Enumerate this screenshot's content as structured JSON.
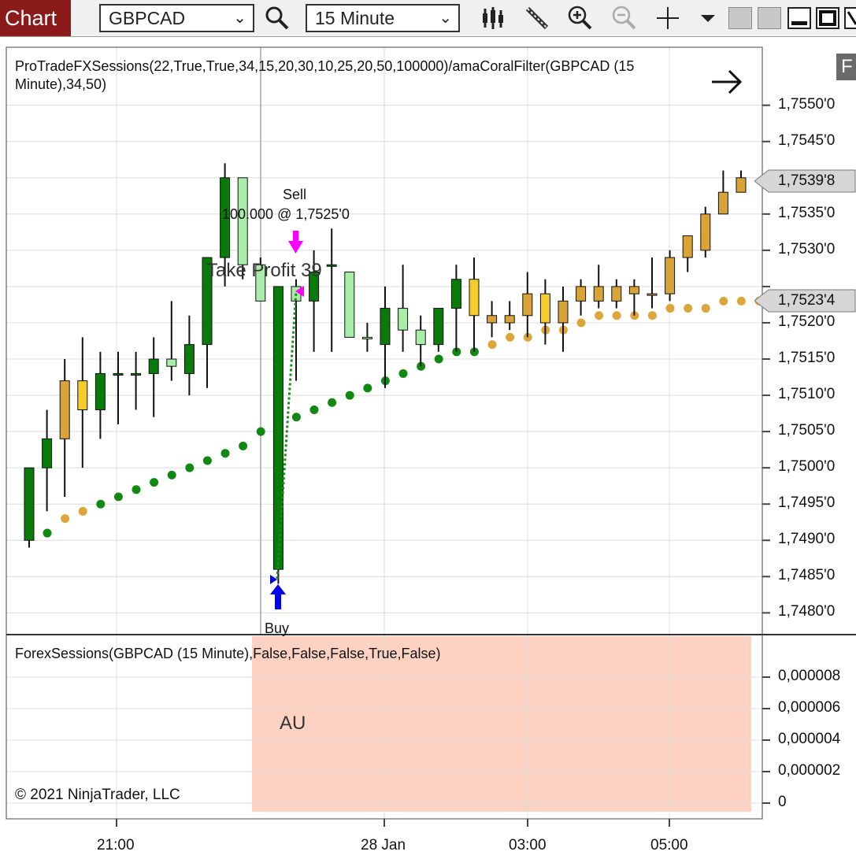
{
  "toolbar": {
    "tab_label": "Chart",
    "instrument": "GBPCAD",
    "interval": "15 Minute"
  },
  "main_panel": {
    "indicator_line1": "ProTradeFXSessions(22,True,True,34,15,20,30,10,25,20,50,100000)/amaCoralFilter(GBPCAD (15",
    "indicator_line2": "Minute),34,50)",
    "sell_label": "Sell",
    "sell_detail": "100.000 @ 1,7525'0",
    "take_profit": "Take Profit",
    "take_profit_count": "39",
    "buy_label": "Buy",
    "price_axis": [
      "1,7550'0",
      "1,7545'0",
      "1,7535'0",
      "1,7530'0",
      "1,7520'0",
      "1,7515'0",
      "1,7510'0",
      "1,7505'0",
      "1,7500'0",
      "1,7495'0",
      "1,7490'0",
      "1,7485'0",
      "1,7480'0"
    ],
    "last_price": "1,7539'8",
    "coral_price": "1,7523'4"
  },
  "lower_panel": {
    "indicator": "ForexSessions(GBPCAD (15 Minute),False,False,False,True,False)",
    "session": "AU",
    "copyright": "© 2021 NinjaTrader, LLC",
    "axis": [
      "0,000008",
      "0,000006",
      "0,000004",
      "0,000002",
      "0"
    ]
  },
  "time_axis": [
    "21:00",
    "28 Jan",
    "03:00",
    "05:00"
  ],
  "colors": {
    "bull_strong": "#0a7a0a",
    "bull_light": "#a8eda8",
    "bull_yellow": "#f5cc2a",
    "bull_gold": "#d9a338",
    "coral_green": "#118811",
    "coral_gold": "#dda63a",
    "session_fill": "#fdd2c2",
    "sell_arrow": "#ff00ff",
    "buy_arrow": "#0000ee"
  },
  "chart_data": {
    "type": "candlestick",
    "ylim": [
      1.7477,
      1.7558
    ],
    "candles": [
      {
        "o": 1.749,
        "h": 1.75,
        "l": 1.7489,
        "c": 1.75,
        "color": "bull_strong"
      },
      {
        "o": 1.75,
        "h": 1.7508,
        "l": 1.7494,
        "c": 1.7504,
        "color": "bull_strong"
      },
      {
        "o": 1.7504,
        "h": 1.7515,
        "l": 1.7496,
        "c": 1.7512,
        "color": "bull_gold"
      },
      {
        "o": 1.7512,
        "h": 1.7518,
        "l": 1.75,
        "c": 1.7508,
        "color": "bull_yellow"
      },
      {
        "o": 1.7508,
        "h": 1.7516,
        "l": 1.7504,
        "c": 1.7513,
        "color": "bull_strong"
      },
      {
        "o": 1.7513,
        "h": 1.7516,
        "l": 1.7506,
        "c": 1.7513,
        "color": "bull_strong"
      },
      {
        "o": 1.7513,
        "h": 1.7516,
        "l": 1.7508,
        "c": 1.7513,
        "color": "bull_strong"
      },
      {
        "o": 1.7513,
        "h": 1.7518,
        "l": 1.7507,
        "c": 1.7515,
        "color": "bull_strong"
      },
      {
        "o": 1.7515,
        "h": 1.7523,
        "l": 1.7512,
        "c": 1.7514,
        "color": "bull_light"
      },
      {
        "o": 1.7513,
        "h": 1.7521,
        "l": 1.751,
        "c": 1.7517,
        "color": "bull_strong"
      },
      {
        "o": 1.7517,
        "h": 1.752,
        "l": 1.7511,
        "c": 1.7529,
        "color": "bull_strong"
      },
      {
        "o": 1.7529,
        "h": 1.7542,
        "l": 1.7525,
        "c": 1.754,
        "color": "bull_strong"
      },
      {
        "o": 1.754,
        "h": 1.754,
        "l": 1.7526,
        "c": 1.7528,
        "color": "bull_light"
      },
      {
        "o": 1.7528,
        "h": 1.7529,
        "l": 1.7523,
        "c": 1.7523,
        "color": "bull_light"
      },
      {
        "o": 1.7486,
        "h": 1.7525,
        "l": 1.7484,
        "c": 1.7525,
        "color": "bull_strong"
      },
      {
        "o": 1.7525,
        "h": 1.7526,
        "l": 1.7512,
        "c": 1.7523,
        "color": "bull_light"
      },
      {
        "o": 1.7523,
        "h": 1.753,
        "l": 1.7516,
        "c": 1.7527,
        "color": "bull_strong"
      },
      {
        "o": 1.7528,
        "h": 1.7533,
        "l": 1.7516,
        "c": 1.7528,
        "color": "bull_strong"
      },
      {
        "o": 1.7527,
        "h": 1.7527,
        "l": 1.7518,
        "c": 1.7518,
        "color": "bull_light"
      },
      {
        "o": 1.7518,
        "h": 1.752,
        "l": 1.7516,
        "c": 1.7518,
        "color": "bull_light"
      },
      {
        "o": 1.7517,
        "h": 1.7525,
        "l": 1.7511,
        "c": 1.7522,
        "color": "bull_strong"
      },
      {
        "o": 1.7522,
        "h": 1.7528,
        "l": 1.7516,
        "c": 1.7519,
        "color": "bull_light"
      },
      {
        "o": 1.7519,
        "h": 1.7521,
        "l": 1.7514,
        "c": 1.7517,
        "color": "bull_light"
      },
      {
        "o": 1.7517,
        "h": 1.7522,
        "l": 1.7516,
        "c": 1.7522,
        "color": "bull_strong"
      },
      {
        "o": 1.7522,
        "h": 1.7528,
        "l": 1.7516,
        "c": 1.7526,
        "color": "bull_strong"
      },
      {
        "o": 1.7526,
        "h": 1.7529,
        "l": 1.7516,
        "c": 1.7521,
        "color": "bull_yellow"
      },
      {
        "o": 1.752,
        "h": 1.7523,
        "l": 1.7518,
        "c": 1.7521,
        "color": "bull_gold"
      },
      {
        "o": 1.752,
        "h": 1.7523,
        "l": 1.7519,
        "c": 1.7521,
        "color": "bull_gold"
      },
      {
        "o": 1.7521,
        "h": 1.7527,
        "l": 1.7518,
        "c": 1.7524,
        "color": "bull_gold"
      },
      {
        "o": 1.7524,
        "h": 1.7526,
        "l": 1.7517,
        "c": 1.752,
        "color": "bull_yellow"
      },
      {
        "o": 1.7523,
        "h": 1.7525,
        "l": 1.7516,
        "c": 1.752,
        "color": "bull_gold"
      },
      {
        "o": 1.7523,
        "h": 1.7526,
        "l": 1.7521,
        "c": 1.7525,
        "color": "bull_gold"
      },
      {
        "o": 1.7523,
        "h": 1.7528,
        "l": 1.7522,
        "c": 1.7525,
        "color": "bull_gold"
      },
      {
        "o": 1.7523,
        "h": 1.7526,
        "l": 1.7522,
        "c": 1.7525,
        "color": "bull_gold"
      },
      {
        "o": 1.7524,
        "h": 1.7526,
        "l": 1.7521,
        "c": 1.7525,
        "color": "bull_gold"
      },
      {
        "o": 1.7524,
        "h": 1.7529,
        "l": 1.7522,
        "c": 1.7524,
        "color": "bull_gold"
      },
      {
        "o": 1.7524,
        "h": 1.753,
        "l": 1.7523,
        "c": 1.7529,
        "color": "bull_gold"
      },
      {
        "o": 1.7529,
        "h": 1.7532,
        "l": 1.7527,
        "c": 1.7532,
        "color": "bull_gold"
      },
      {
        "o": 1.753,
        "h": 1.7536,
        "l": 1.7529,
        "c": 1.7535,
        "color": "bull_gold"
      },
      {
        "o": 1.7535,
        "h": 1.7541,
        "l": 1.7535,
        "c": 1.7538,
        "color": "bull_gold"
      },
      {
        "o": 1.7538,
        "h": 1.7541,
        "l": 1.7538,
        "c": 1.754,
        "color": "bull_gold"
      }
    ],
    "coral": [
      {
        "v": 1.7491,
        "color": "coral_green"
      },
      {
        "v": 1.7493,
        "color": "coral_gold"
      },
      {
        "v": 1.7494,
        "color": "coral_gold"
      },
      {
        "v": 1.7495,
        "color": "coral_green"
      },
      {
        "v": 1.7496,
        "color": "coral_green"
      },
      {
        "v": 1.7497,
        "color": "coral_green"
      },
      {
        "v": 1.7498,
        "color": "coral_green"
      },
      {
        "v": 1.7499,
        "color": "coral_green"
      },
      {
        "v": 1.75,
        "color": "coral_green"
      },
      {
        "v": 1.7501,
        "color": "coral_green"
      },
      {
        "v": 1.7502,
        "color": "coral_green"
      },
      {
        "v": 1.7503,
        "color": "coral_green"
      },
      {
        "v": 1.7505,
        "color": "coral_green"
      },
      {
        "v": 1.7507,
        "color": "coral_green"
      },
      {
        "v": 1.7507,
        "color": "coral_green"
      },
      {
        "v": 1.7508,
        "color": "coral_green"
      },
      {
        "v": 1.7509,
        "color": "coral_green"
      },
      {
        "v": 1.751,
        "color": "coral_green"
      },
      {
        "v": 1.7511,
        "color": "coral_green"
      },
      {
        "v": 1.7512,
        "color": "coral_green"
      },
      {
        "v": 1.7513,
        "color": "coral_green"
      },
      {
        "v": 1.7514,
        "color": "coral_green"
      },
      {
        "v": 1.7515,
        "color": "coral_green"
      },
      {
        "v": 1.7516,
        "color": "coral_green"
      },
      {
        "v": 1.7516,
        "color": "coral_green"
      },
      {
        "v": 1.7517,
        "color": "coral_gold"
      },
      {
        "v": 1.7518,
        "color": "coral_gold"
      },
      {
        "v": 1.7518,
        "color": "coral_gold"
      },
      {
        "v": 1.7519,
        "color": "coral_gold"
      },
      {
        "v": 1.7519,
        "color": "coral_gold"
      },
      {
        "v": 1.752,
        "color": "coral_gold"
      },
      {
        "v": 1.7521,
        "color": "coral_gold"
      },
      {
        "v": 1.7521,
        "color": "coral_gold"
      },
      {
        "v": 1.7521,
        "color": "coral_gold"
      },
      {
        "v": 1.7521,
        "color": "coral_gold"
      },
      {
        "v": 1.7522,
        "color": "coral_gold"
      },
      {
        "v": 1.7522,
        "color": "coral_gold"
      },
      {
        "v": 1.7522,
        "color": "coral_gold"
      },
      {
        "v": 1.7523,
        "color": "coral_gold"
      },
      {
        "v": 1.7523,
        "color": "coral_gold"
      },
      {
        "v": 1.7523,
        "color": "coral_gold"
      }
    ]
  }
}
